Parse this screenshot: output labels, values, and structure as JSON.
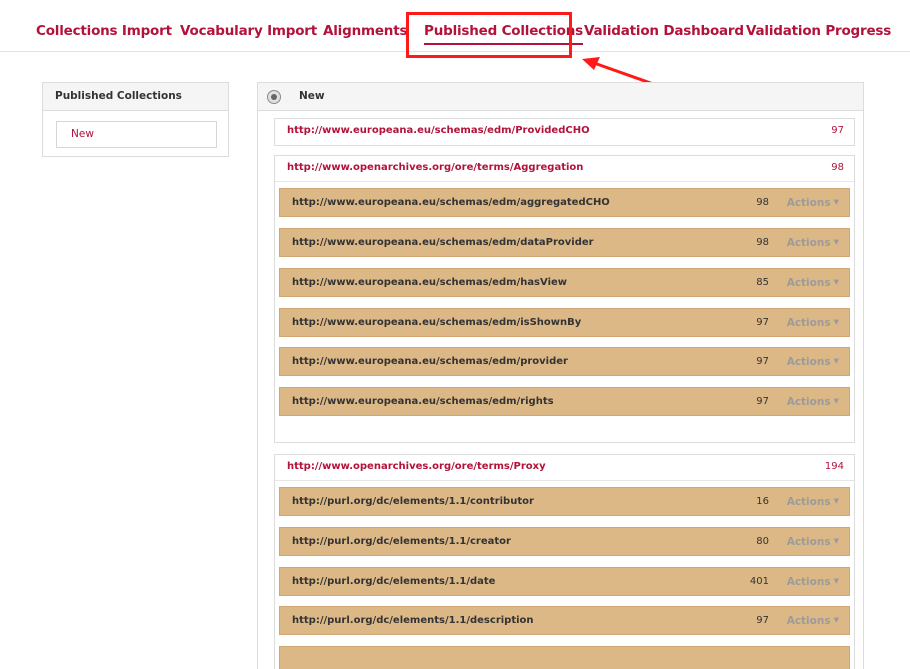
{
  "nav": {
    "tabs": [
      {
        "label": "Collections Import"
      },
      {
        "label": "Vocabulary Import"
      },
      {
        "label": "Alignments"
      },
      {
        "label": "Published Collections"
      },
      {
        "label": "Validation Dashboard"
      },
      {
        "label": "Validation Progress"
      }
    ]
  },
  "sidebar": {
    "title": "Published Collections",
    "item": "New"
  },
  "main": {
    "title": "New",
    "actions_label": "Actions",
    "groups": [
      {
        "uri": "http://www.europeana.eu/schemas/edm/ProvidedCHO",
        "count": "97"
      },
      {
        "uri": "http://www.openarchives.org/ore/terms/Aggregation",
        "count": "98",
        "rows": [
          {
            "uri": "http://www.europeana.eu/schemas/edm/aggregatedCHO",
            "count": "98"
          },
          {
            "uri": "http://www.europeana.eu/schemas/edm/dataProvider",
            "count": "98"
          },
          {
            "uri": "http://www.europeana.eu/schemas/edm/hasView",
            "count": "85"
          },
          {
            "uri": "http://www.europeana.eu/schemas/edm/isShownBy",
            "count": "97"
          },
          {
            "uri": "http://www.europeana.eu/schemas/edm/provider",
            "count": "97"
          },
          {
            "uri": "http://www.europeana.eu/schemas/edm/rights",
            "count": "97"
          }
        ]
      },
      {
        "uri": "http://www.openarchives.org/ore/terms/Proxy",
        "count": "194",
        "rows": [
          {
            "uri": "http://purl.org/dc/elements/1.1/contributor",
            "count": "16"
          },
          {
            "uri": "http://purl.org/dc/elements/1.1/creator",
            "count": "80"
          },
          {
            "uri": "http://purl.org/dc/elements/1.1/date",
            "count": "401"
          },
          {
            "uri": "http://purl.org/dc/elements/1.1/description",
            "count": "97"
          }
        ]
      }
    ]
  },
  "colors": {
    "accent": "#b3123a",
    "row_bg": "#ddb887",
    "highlight": "#ff1a1a"
  }
}
